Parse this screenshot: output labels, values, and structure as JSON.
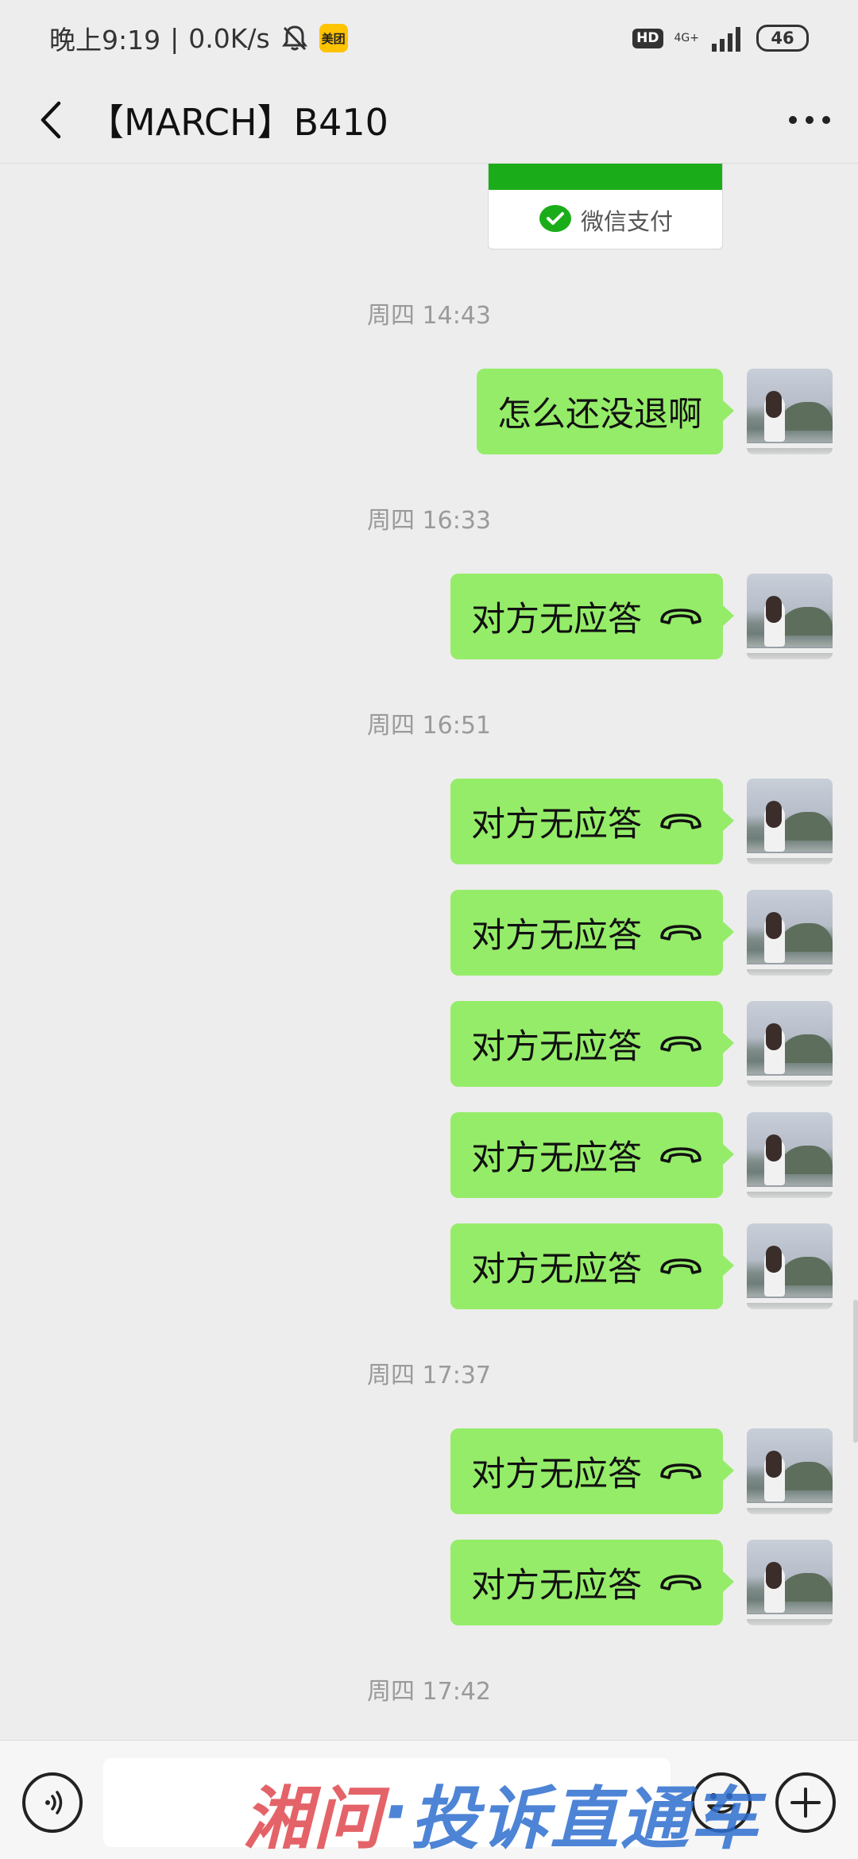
{
  "status_bar": {
    "time": "晚上9:19",
    "separator": "|",
    "speed": "0.0K/s",
    "app_badge": "美团",
    "hd_label": "HD",
    "network_label": "4G+",
    "battery": "46",
    "icons": [
      "bell-off-icon",
      "signal-icon"
    ]
  },
  "header": {
    "title": "【MARCH】B410",
    "icons": [
      "back-arrow-icon",
      "more-dots-icon"
    ]
  },
  "pay_card": {
    "label": "微信支付",
    "brand_color": "#1aad19"
  },
  "timestamps": [
    "周四 14:43",
    "周四 16:33",
    "周四 16:51",
    "周四 17:37",
    "周四 17:42"
  ],
  "messages": [
    {
      "text": "怎么还没退啊",
      "type": "text"
    },
    {
      "text": "对方无应答",
      "type": "call"
    },
    {
      "text": "对方无应答",
      "type": "call"
    },
    {
      "text": "对方无应答",
      "type": "call"
    },
    {
      "text": "对方无应答",
      "type": "call"
    },
    {
      "text": "对方无应答",
      "type": "call"
    },
    {
      "text": "对方无应答",
      "type": "call"
    },
    {
      "text": "对方无应答",
      "type": "call"
    },
    {
      "text": "对方无应答",
      "type": "call"
    }
  ],
  "colors": {
    "bubble": "#95ec69",
    "background": "#ededed",
    "timestamp": "#9a9a9a"
  },
  "input_bar": {
    "message_value": "",
    "icons": [
      "voice-icon",
      "emoji-icon",
      "plus-icon"
    ]
  },
  "watermark": {
    "part_a": "湘问",
    "dot": "·",
    "part_b": "投诉直通车"
  }
}
